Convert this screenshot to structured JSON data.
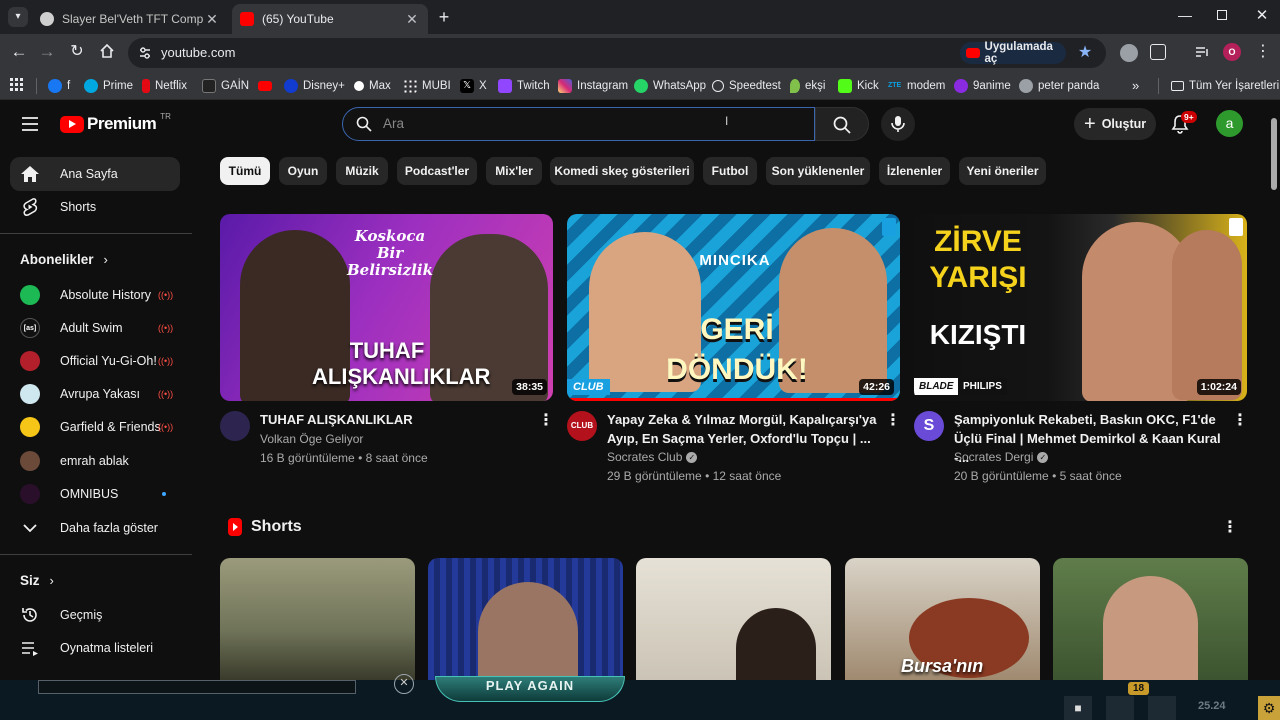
{
  "browser": {
    "tabs": [
      {
        "title": "Slayer Bel'Veth TFT Comp Guide",
        "active": false
      },
      {
        "title": "(65) YouTube",
        "active": true
      }
    ],
    "url": "youtube.com",
    "open_in_app": "Uygulamada aç",
    "profile_initial": "O",
    "bookmarks": [
      {
        "label": "f",
        "color": "#1877f2"
      },
      {
        "label": "Prime",
        "color": "#00a8e1"
      },
      {
        "label": "Netflix",
        "color": "#e50914"
      },
      {
        "label": "GAİN",
        "color": "#222222"
      },
      {
        "label": "",
        "color": "#ff0000"
      },
      {
        "label": "Disney+",
        "color": "#113ccf"
      },
      {
        "label": "Max",
        "color": "#ffffff"
      },
      {
        "label": "MUBI",
        "color": "#ffffff"
      },
      {
        "label": "X",
        "color": "#000000"
      },
      {
        "label": "Twitch",
        "color": "#9146ff"
      },
      {
        "label": "Instagram",
        "color": "#e1306c"
      },
      {
        "label": "WhatsApp",
        "color": "#25d366"
      },
      {
        "label": "Speedtest",
        "color": "#141526"
      },
      {
        "label": "ekşi",
        "color": "#81c14b"
      },
      {
        "label": "Kick",
        "color": "#53fc18"
      },
      {
        "label": "modem",
        "color": "#0a6ebd"
      },
      {
        "label": "9anime",
        "color": "#8a2be2"
      },
      {
        "label": "peter panda",
        "color": "#9aa0a6"
      }
    ],
    "all_bookmarks": "Tüm Yer İşaretleri"
  },
  "youtube": {
    "logo_text": "Premium",
    "logo_badge": "TR",
    "search_placeholder": "Ara",
    "create_label": "Oluştur",
    "notif_count": "9+",
    "user_initial": "a",
    "sidebar": {
      "home": "Ana Sayfa",
      "shorts": "Shorts",
      "subs_title": "Abonelikler",
      "subs": [
        {
          "name": "Absolute History",
          "color": "#1db954",
          "badge": "live"
        },
        {
          "name": "Adult Swim",
          "color": "#111111",
          "badge": "live"
        },
        {
          "name": "Official Yu-Gi-Oh!",
          "color": "#b3202c",
          "badge": "live"
        },
        {
          "name": "Avrupa Yakası",
          "color": "#cfe8f0",
          "badge": "live"
        },
        {
          "name": "Garfield & Friends",
          "color": "#f5c518",
          "badge": "live"
        },
        {
          "name": "emrah ablak",
          "color": "#6b4a3a",
          "badge": ""
        },
        {
          "name": "OMNIBUS",
          "color": "#2a0f2a",
          "badge": "new"
        }
      ],
      "show_more": "Daha fazla göster",
      "you_title": "Siz",
      "history": "Geçmiş",
      "playlists": "Oynatma listeleri"
    },
    "chips": [
      "Tümü",
      "Oyun",
      "Müzik",
      "Podcast'ler",
      "Mix'ler",
      "Komedi skeç gösterileri",
      "Futbol",
      "Son yüklenenler",
      "İzlenenler",
      "Yeni öneriler"
    ],
    "videos": [
      {
        "thumb_text_top": "Koskoca Bir Belirsizlik",
        "thumb_text_main": "TUHAF ALIŞKANLIKLAR",
        "duration": "38:35",
        "title": "TUHAF ALIŞKANLIKLAR",
        "channel": "Volkan Öge Geliyor",
        "meta": "16 B görüntüleme • 8 saat önce",
        "colors": [
          "#6a1fb0",
          "#c33bbd"
        ]
      },
      {
        "thumb_text_top": "MINCIKA",
        "thumb_text_main": "GERİ DÖNDÜK!",
        "duration": "42:26",
        "title": "Yapay Zeka & Yılmaz Morgül, Kapalıçarşı'ya Ayıp, En Saçma Yerler, Oxford'lu Topçu | ...",
        "channel": "Socrates Club",
        "meta": "29 B görüntüleme • 12 saat önce",
        "colors": [
          "#1aa3d9",
          "#0b5c8a"
        ]
      },
      {
        "thumb_text_top": "ZİRVE YARIŞI",
        "thumb_text_main": "KIZIŞTI",
        "duration": "1:02:24",
        "title": "Şampiyonluk Rekabeti, Baskın OKC, F1'de Üçlü Final | Mehmet Demirkol & Kaan Kural -...",
        "channel": "Socrates Dergi",
        "meta": "20 B görüntüleme • 5 saat önce",
        "colors": [
          "#111111",
          "#e6c21a"
        ]
      }
    ],
    "club_tag": "CLUB",
    "blade_tag": "BLADE",
    "philips_tag": "PHILIPS",
    "shorts_title": "Shorts",
    "shorts": [
      {
        "color": "#8a8c73",
        "caption": ""
      },
      {
        "color": "#2a3b8f",
        "caption": ""
      },
      {
        "color": "#d8d2c6",
        "caption": ""
      },
      {
        "color": "#c9c2b6",
        "caption": "Bursa'nın"
      },
      {
        "color": "#4d6b3d",
        "caption": ""
      }
    ]
  },
  "overlay": {
    "play_again": "PLAY AGAIN",
    "count": "18",
    "time": "25.24"
  }
}
